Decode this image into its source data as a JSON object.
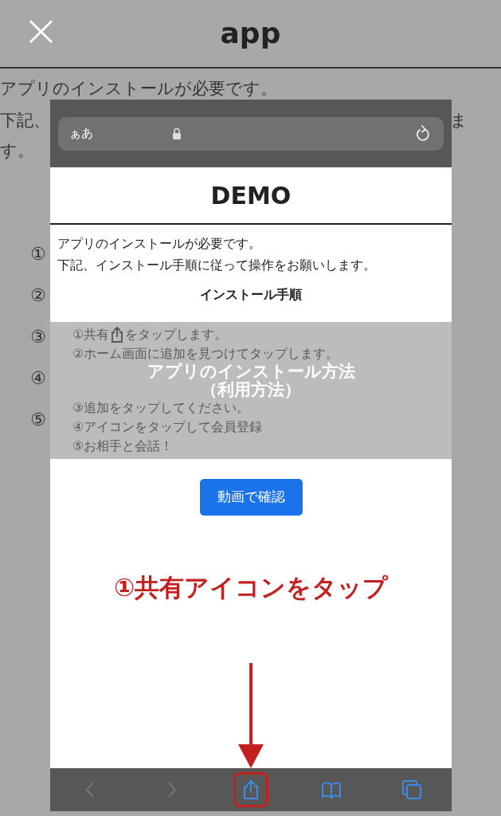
{
  "header": {
    "close": "×",
    "title": "app"
  },
  "background_text": {
    "line_1": "アプリのインストールが必要です。",
    "line_2_start": "下記、",
    "line_2_end": "ま",
    "line_3": "す。"
  },
  "background_steps": [
    "①",
    "②",
    "③",
    "④",
    "⑤"
  ],
  "tutorial": {
    "address_bar": {
      "text_size": "ぁあ"
    },
    "site_title": "DEMO",
    "intro": [
      "アプリのインストールが必要です。",
      "下記、インストール手順に従って操作をお願いします。"
    ],
    "steps_heading": "インストール手順",
    "steps": [
      {
        "kind": "icon",
        "before": "①共有",
        "after": "をタップします。"
      },
      {
        "kind": "text",
        "text": "②ホーム画面に追加を見つけてタップします。"
      },
      {
        "kind": "text",
        "text": "③追加をタップしてください。"
      },
      {
        "kind": "text",
        "text": "④アイコンをタップして会員登録"
      },
      {
        "kind": "text",
        "text": "⑤お相手と会話！"
      }
    ],
    "overlay_title": [
      "アプリのインストール方法",
      "（利用方法）"
    ],
    "video_button": "動画で確認",
    "instruction": "①共有アイコンをタップ",
    "toolbar": [
      {
        "kind": "back",
        "disabled": true,
        "selected": false
      },
      {
        "kind": "forward",
        "disabled": true,
        "selected": false
      },
      {
        "kind": "share",
        "disabled": false,
        "selected": true
      },
      {
        "kind": "bookmarks",
        "disabled": false,
        "selected": false
      },
      {
        "kind": "tabs",
        "disabled": false,
        "selected": false
      }
    ]
  }
}
